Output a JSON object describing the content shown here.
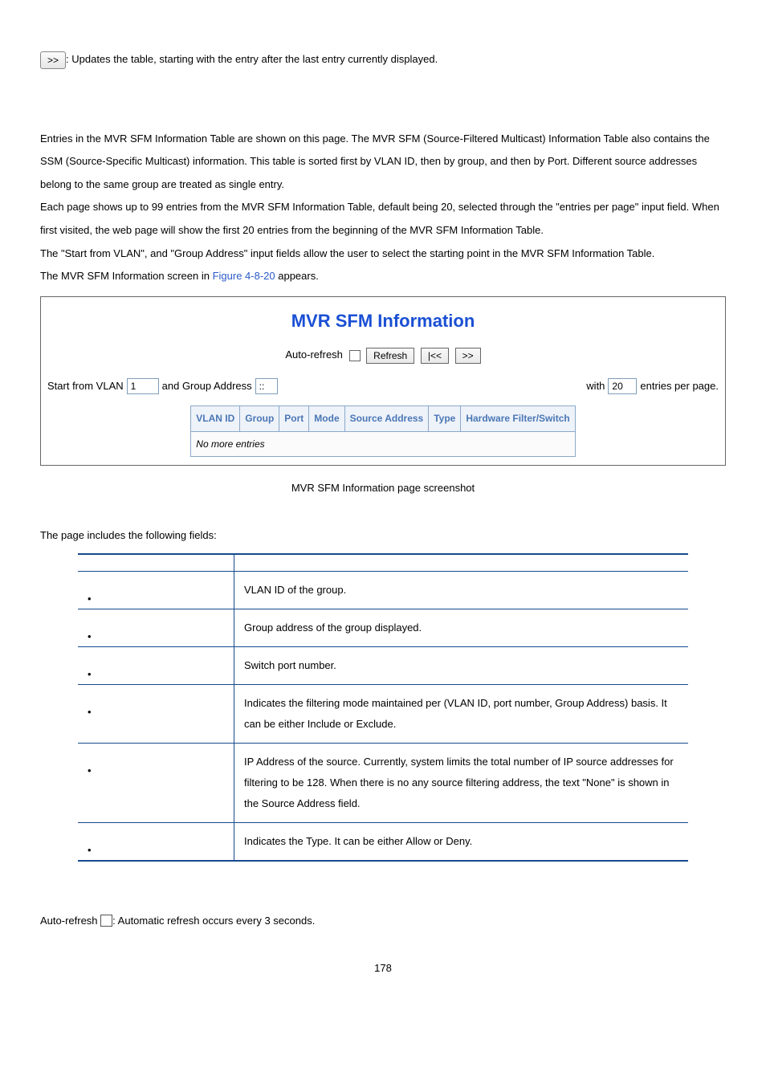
{
  "top_button_label": ">>",
  "top_button_desc": ": Updates the table, starting with the entry after the last entry currently displayed.",
  "para1": "Entries in the MVR SFM Information Table are shown on this page. The MVR SFM (Source-Filtered Multicast) Information Table also contains the SSM (Source-Specific Multicast) information. This table is sorted first by VLAN ID, then by group, and then by Port. Different source addresses belong to the same group are treated as single entry.",
  "para2": "Each page shows up to 99 entries from the MVR SFM Information Table, default being 20, selected through the \"entries per page\" input field. When first visited, the web page will show the first 20 entries from the beginning of the MVR SFM Information Table.",
  "para3": "The \"Start from VLAN\", and \"Group Address\" input fields allow the user to select the starting point in the MVR SFM Information Table.",
  "para4_pre": "The MVR SFM Information screen in ",
  "para4_link": "Figure 4-8-20",
  "para4_post": " appears.",
  "figure": {
    "title": "MVR SFM Information",
    "auto_refresh_label": "Auto-refresh",
    "refresh_btn": "Refresh",
    "first_btn": "|<<",
    "next_btn": ">>",
    "start_from_vlan_label": "Start from VLAN",
    "start_from_vlan_value": "1",
    "and_group_label": "and Group Address",
    "group_value": "::",
    "with_label": "with",
    "with_value": "20",
    "entries_per_page_label": "entries per page.",
    "columns": [
      "VLAN ID",
      "Group",
      "Port",
      "Mode",
      "Source Address",
      "Type",
      "Hardware Filter/Switch"
    ],
    "no_more": "No more entries"
  },
  "caption": "MVR SFM Information page screenshot",
  "fields_intro": "The page includes the following fields:",
  "fields": [
    {
      "desc": "VLAN ID of the group."
    },
    {
      "desc": "Group address of the group displayed."
    },
    {
      "desc": "Switch port number."
    },
    {
      "desc": "Indicates the filtering mode maintained per (VLAN ID, port number, Group Address) basis. It can be either Include or Exclude."
    },
    {
      "desc": "IP Address of the source. Currently, system limits the total number of IP source addresses for filtering to be 128. When there is no any source filtering address, the text \"None\" is shown in the Source Address field."
    },
    {
      "desc": "Indicates the Type. It can be either Allow or Deny."
    }
  ],
  "auto_refresh_line_pre": "Auto-refresh ",
  "auto_refresh_line_post": ": Automatic refresh occurs every 3 seconds.",
  "page_number": "178"
}
